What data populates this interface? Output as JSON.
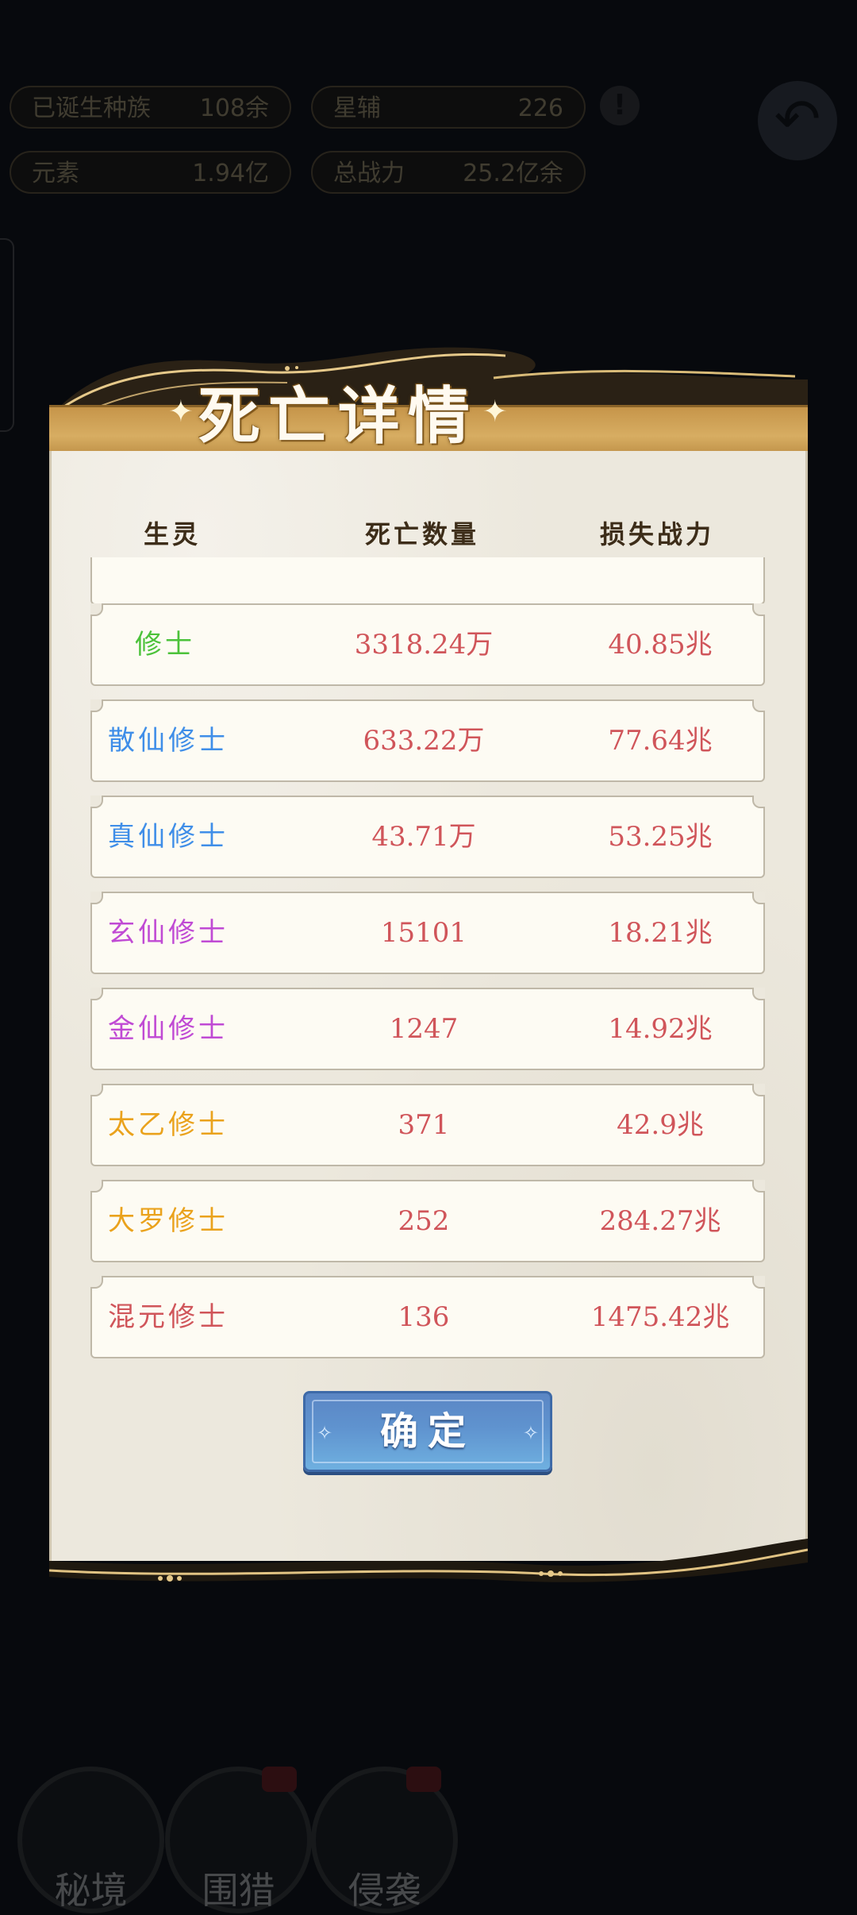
{
  "background": {
    "stats": [
      {
        "label": "已诞生种族",
        "value": "108余"
      },
      {
        "label": "星辅",
        "value": "226"
      },
      {
        "label": "元素",
        "value": "1.94亿"
      },
      {
        "label": "总战力",
        "value": "25.2亿余"
      }
    ],
    "bottom_nav": [
      {
        "label": "秘境"
      },
      {
        "label": "围猎"
      },
      {
        "label": "侵袭"
      }
    ]
  },
  "dialog": {
    "title": "死亡详情",
    "title_ornament": "✦",
    "columns": {
      "creature": "生灵",
      "death_count": "死亡数量",
      "power_loss": "损失战力"
    },
    "rows": [
      {
        "name": "修士",
        "count": "3318.24万",
        "loss": "40.85兆",
        "color": "#4cc23a"
      },
      {
        "name": "散仙修士",
        "count": "633.22万",
        "loss": "77.64兆",
        "color": "#3f8ee8"
      },
      {
        "name": "真仙修士",
        "count": "43.71万",
        "loss": "53.25兆",
        "color": "#3f8ee8"
      },
      {
        "name": "玄仙修士",
        "count": "15101",
        "loss": "18.21兆",
        "color": "#c04ad4"
      },
      {
        "name": "金仙修士",
        "count": "1247",
        "loss": "14.92兆",
        "color": "#c04ad4"
      },
      {
        "name": "太乙修士",
        "count": "371",
        "loss": "42.9兆",
        "color": "#eaa21c"
      },
      {
        "name": "大罗修士",
        "count": "252",
        "loss": "284.27兆",
        "color": "#eaa21c"
      },
      {
        "name": "混元修士",
        "count": "136",
        "loss": "1475.42兆",
        "color": "#d0555a"
      }
    ],
    "confirm_label": "确定",
    "confirm_sparkle": "✧"
  }
}
